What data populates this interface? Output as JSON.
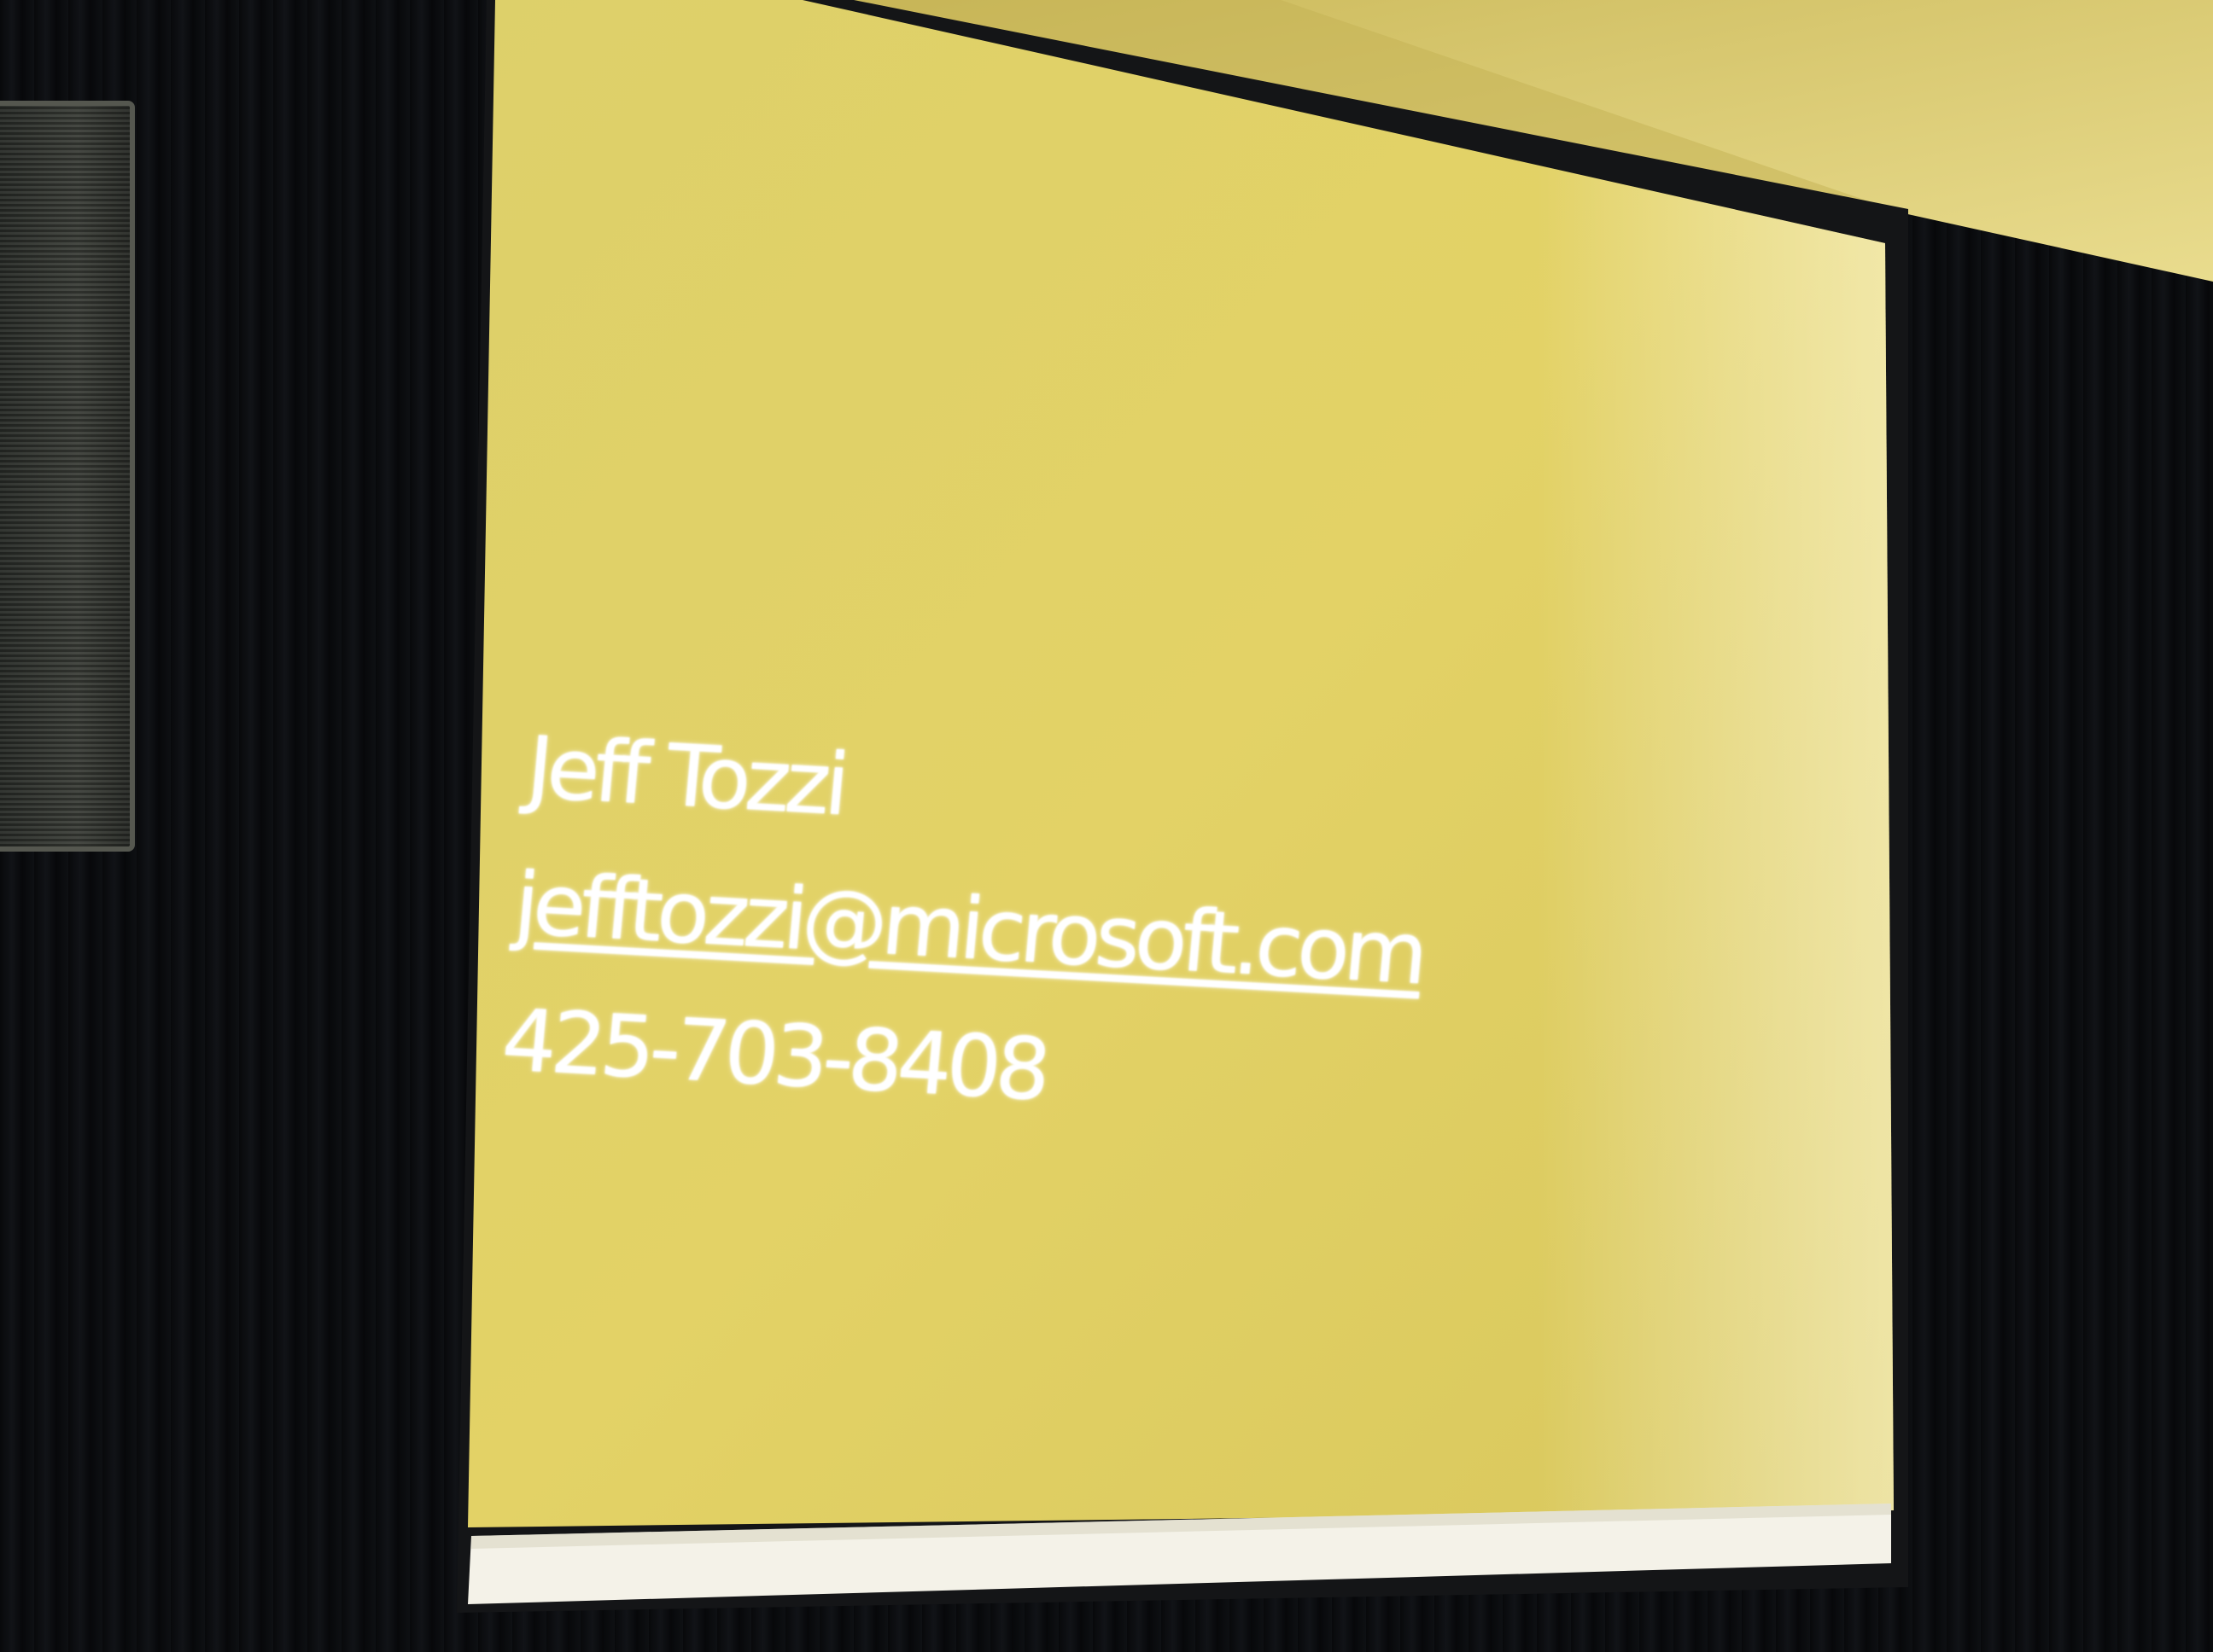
{
  "slide": {
    "name": "Jeff Tozzi",
    "email": "jefftozzi@microsoft.com",
    "phone": "425-703-8408",
    "background_color": "#e3d266",
    "text_color": "#ffffff"
  }
}
